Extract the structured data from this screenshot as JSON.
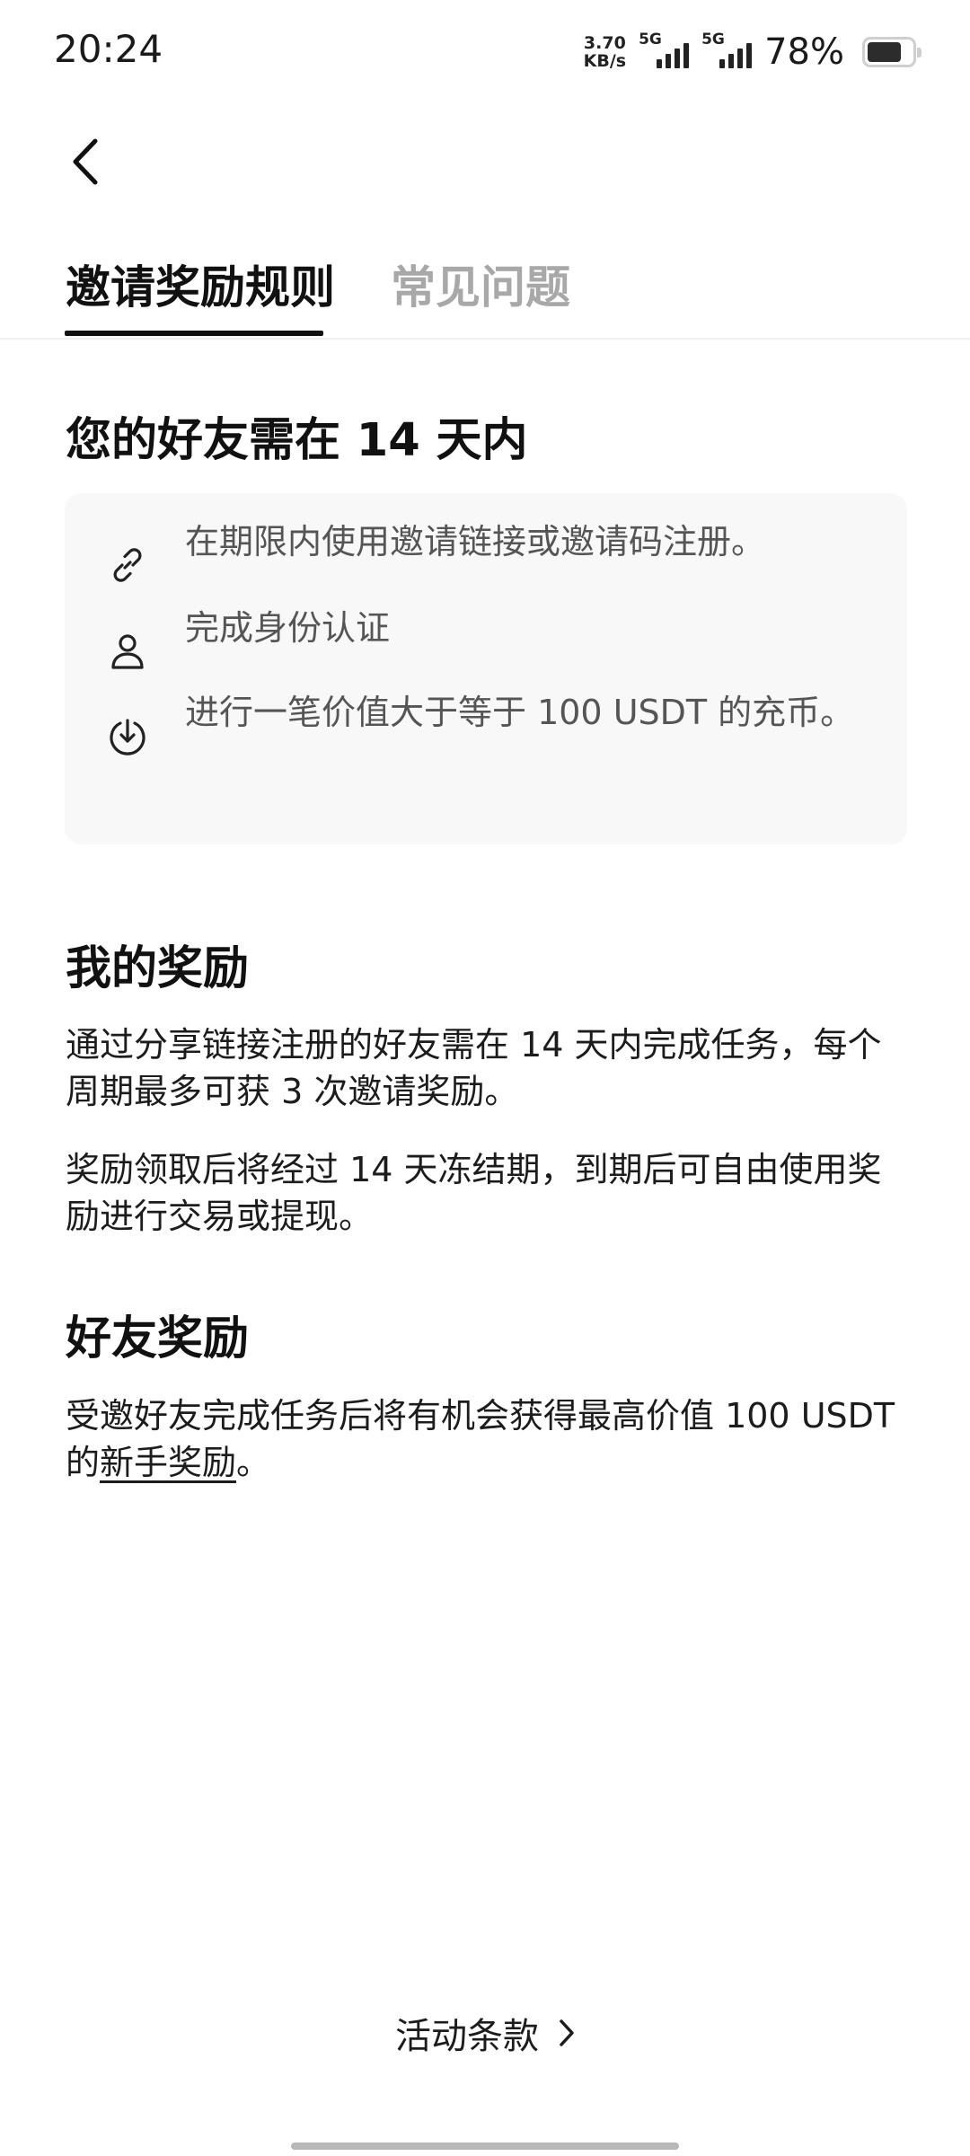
{
  "status_bar": {
    "time": "20:24",
    "speed_value": "3.70",
    "speed_unit": "KB/s",
    "net1": "5G",
    "net2": "5G",
    "battery_percent": "78%",
    "battery_level": 0.78
  },
  "tabs": [
    {
      "label": "邀请奖励规则",
      "active": true
    },
    {
      "label": "常见问题",
      "active": false
    }
  ],
  "section_requirements": {
    "title": "您的好友需在 14 天内",
    "items": [
      {
        "icon": "link-icon",
        "text": "在期限内使用邀请链接或邀请码注册。"
      },
      {
        "icon": "user-icon",
        "text": "完成身份认证"
      },
      {
        "icon": "download-circle-icon",
        "text": "进行一笔价值大于等于 100 USDT 的充币。"
      }
    ]
  },
  "section_my_rewards": {
    "title": "我的奖励",
    "para1": "通过分享链接注册的好友需在 14 天内完成任务，每个周期最多可获 3 次邀请奖励。",
    "para2": "奖励领取后将经过 14 天冻结期，到期后可自由使用奖励进行交易或提现。"
  },
  "section_friend_rewards": {
    "title": "好友奖励",
    "text_before": "受邀好友完成任务后将有机会获得最高价值 100 USDT 的",
    "link_text": "新手奖励",
    "text_after": "。"
  },
  "footer": {
    "terms_label": "活动条款"
  }
}
